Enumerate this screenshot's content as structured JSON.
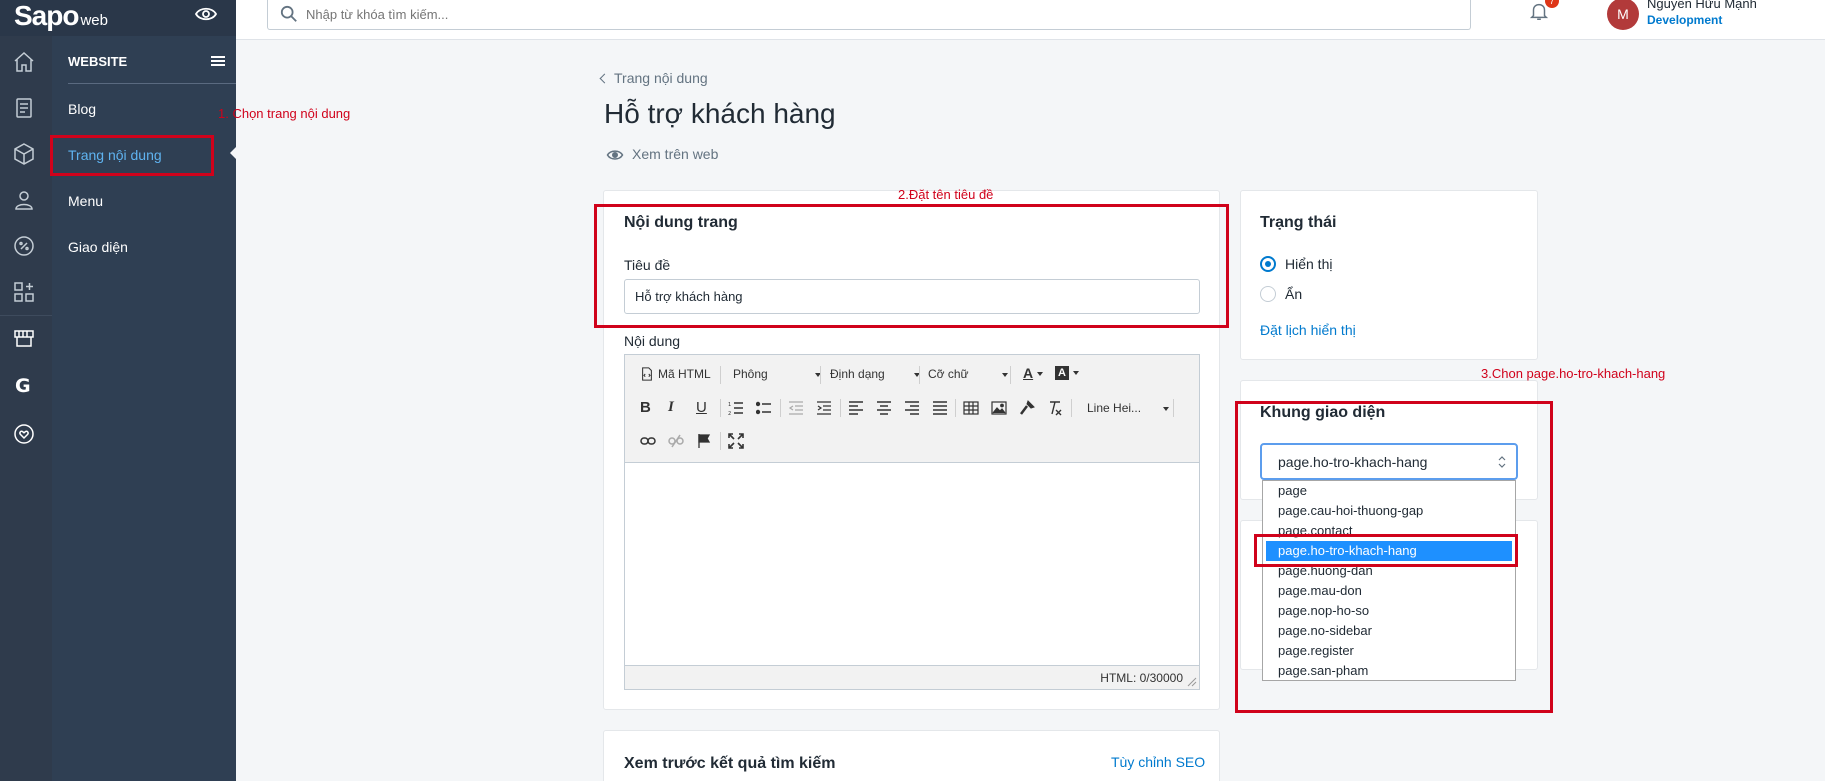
{
  "app": {
    "logo_text": "Sapo",
    "logo_suffix": "web"
  },
  "subbar": {
    "title": "WEBSITE",
    "items": [
      {
        "label": "Blog"
      },
      {
        "label": "Trang nội dung"
      },
      {
        "label": "Menu"
      },
      {
        "label": "Giao diện"
      }
    ]
  },
  "topbar": {
    "search_placeholder": "Nhập từ khóa tìm kiếm...",
    "notification_count": "7",
    "user_initial": "M",
    "user_name": "Nguyễn Hữu Mạnh",
    "user_role": "Development"
  },
  "annotations": {
    "step1": "1. Chọn trang nội dung",
    "step2": "2.Đặt tên tiêu đề",
    "step3": "3.Chon page.ho-tro-khach-hang"
  },
  "page": {
    "back_label": "Trang nội dung",
    "title": "Hỗ trợ khách hàng",
    "view_on_web": "Xem trên web"
  },
  "content_card": {
    "title": "Nội dung trang",
    "title_label": "Tiêu đề",
    "title_value": "Hỗ trợ khách hàng",
    "content_label": "Nội dung",
    "editor": {
      "html_button": "Mã HTML",
      "font_select": "Phông",
      "format_select": "Định dạng",
      "size_select": "Cỡ chữ",
      "line_height_select": "Line Hei...",
      "status": "HTML: 0/30000"
    }
  },
  "seo_card": {
    "title": "Xem trước kết quả tìm kiếm",
    "customize_link": "Tùy chỉnh SEO"
  },
  "status_card": {
    "title": "Trạng thái",
    "options": [
      {
        "label": "Hiển thị",
        "checked": true
      },
      {
        "label": "Ẩn",
        "checked": false
      }
    ],
    "schedule_link": "Đặt lịch hiển thị"
  },
  "template_card": {
    "title": "Khung giao diện",
    "selected": "page.ho-tro-khach-hang",
    "options": [
      "page",
      "page.cau-hoi-thuong-gap",
      "page.contact",
      "page.ho-tro-khach-hang",
      "page.huong-dan",
      "page.mau-don",
      "page.nop-ho-so",
      "page.no-sidebar",
      "page.register",
      "page.san-pham"
    ]
  },
  "colors": {
    "sidebar": "#2f3b4c",
    "accent": "#007ace",
    "annotation": "#d0021b"
  }
}
